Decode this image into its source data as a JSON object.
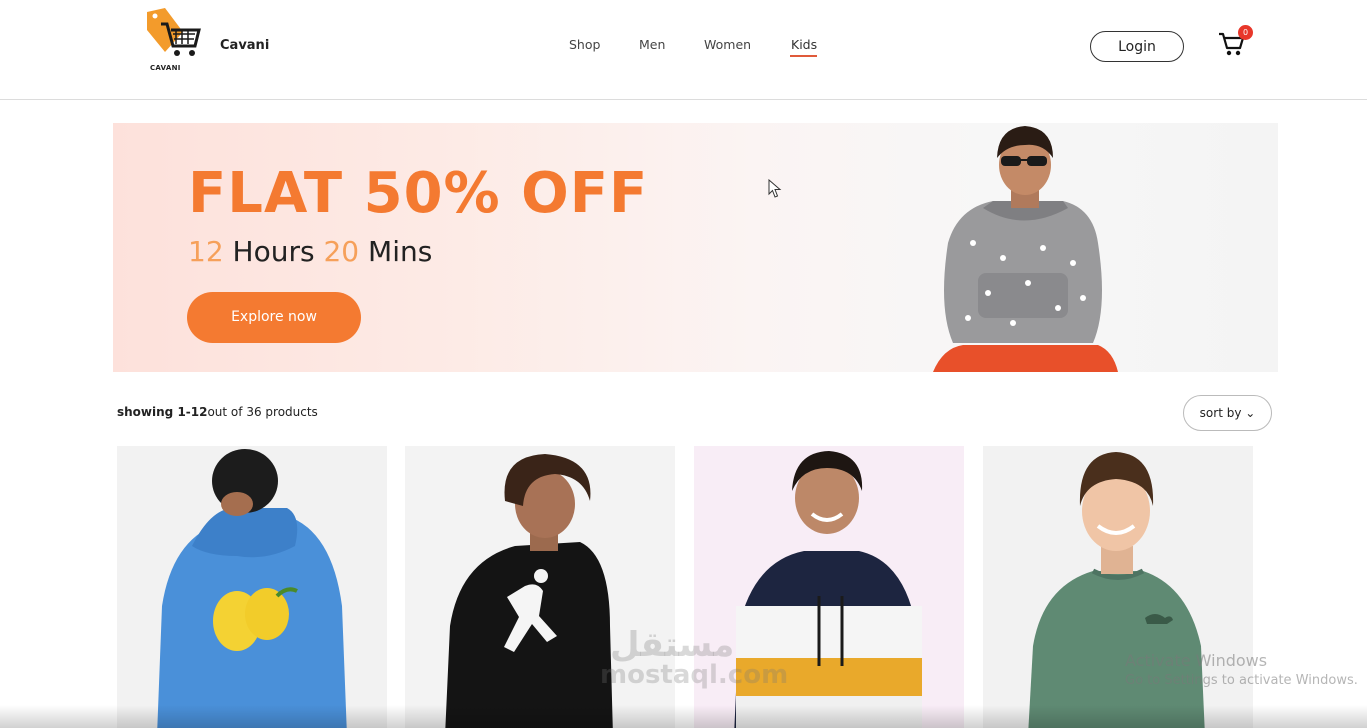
{
  "header": {
    "logo_text": "CAVANI",
    "brand": "Cavani",
    "nav": [
      "Shop",
      "Men",
      "Women",
      "Kids"
    ],
    "active_nav": "Kids",
    "login_label": "Login",
    "cart_count": "0"
  },
  "banner": {
    "title": "FLAT 50% OFF",
    "hours": "12",
    "hours_label": "Hours",
    "mins": "20",
    "mins_label": "Mins",
    "cta": "Explore now"
  },
  "products": {
    "showing_bold": "showing 1-12",
    "showing_rest": "out of 36 products",
    "sort_label": "sort by"
  },
  "overlay": {
    "watermark_ar": "مستقل",
    "watermark_en": "mostaql.com",
    "activate_title": "Activate Windows",
    "activate_sub": "Go to Settings to activate Windows."
  },
  "colors": {
    "accent": "#f47a31",
    "badge": "#e8372a",
    "nav_underline": "#e05a3a"
  }
}
